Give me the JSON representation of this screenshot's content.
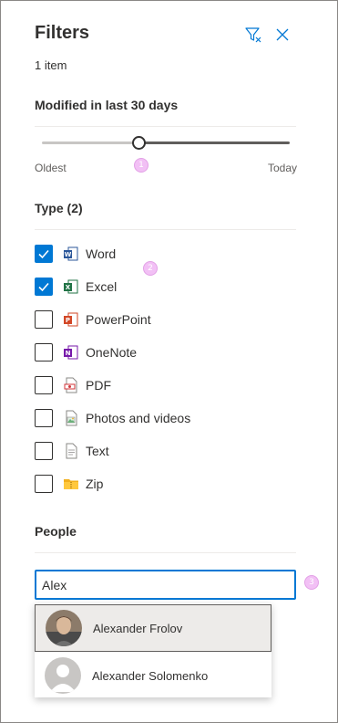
{
  "panel": {
    "title": "Filters",
    "item_count": "1 item"
  },
  "modified": {
    "title": "Modified in last 30 days",
    "slider_value_fraction": 0.39,
    "min_label": "Oldest",
    "max_label": "Today"
  },
  "type": {
    "title": "Type (2)",
    "items": [
      {
        "label": "Word",
        "checked": true,
        "icon": "word-icon"
      },
      {
        "label": "Excel",
        "checked": true,
        "icon": "excel-icon"
      },
      {
        "label": "PowerPoint",
        "checked": false,
        "icon": "powerpoint-icon"
      },
      {
        "label": "OneNote",
        "checked": false,
        "icon": "onenote-icon"
      },
      {
        "label": "PDF",
        "checked": false,
        "icon": "pdf-icon"
      },
      {
        "label": "Photos and videos",
        "checked": false,
        "icon": "photo-icon"
      },
      {
        "label": "Text",
        "checked": false,
        "icon": "text-file-icon"
      },
      {
        "label": "Zip",
        "checked": false,
        "icon": "zip-folder-icon"
      }
    ]
  },
  "people": {
    "title": "People",
    "search_value": "Alex",
    "suggestions": [
      {
        "name": "Alexander Frolov",
        "selected": true
      },
      {
        "name": "Alexander Solomenko",
        "selected": false
      }
    ]
  },
  "badges": [
    "1",
    "2",
    "3"
  ],
  "colors": {
    "accent": "#0078d4",
    "badge": "#f2c0f5",
    "word": "#2b579a",
    "excel": "#217346",
    "powerpoint": "#d24726",
    "onenote": "#7719aa",
    "zip": "#f2b01e"
  }
}
